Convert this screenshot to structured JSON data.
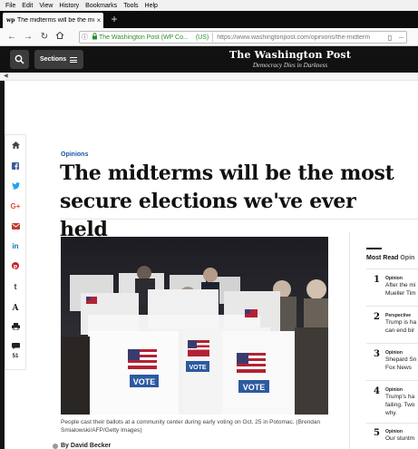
{
  "menu": [
    "File",
    "Edit",
    "View",
    "History",
    "Bookmarks",
    "Tools",
    "Help"
  ],
  "tab": {
    "title": "The midterms will be the most"
  },
  "urlbar": {
    "site": "The Washington Post (WP Co...",
    "country": "(US)",
    "url": "https://www.washingtonpost.com/opinions/the-midterm"
  },
  "header": {
    "sections_label": "Sections",
    "logo_name": "The Washington Post",
    "logo_tagline": "Democracy Dies in Darkness"
  },
  "share": {
    "comment_count": "51"
  },
  "article": {
    "kicker": "Opinions",
    "headline_line1": "The midterms will be the most",
    "headline_line2": "secure elections we've ever held",
    "caption": "People cast their ballots at a community center during early voting on Oct. 25 in Potomac. (Brendan Smialowski/AFP/Getty Images)",
    "byline": "By David Becker"
  },
  "photo": {
    "booth_sign": "VOTE"
  },
  "most_read": {
    "title_a": "Most Read",
    "title_b": "Opin",
    "items": [
      {
        "num": "1",
        "kicker": "Opinion",
        "line1": "After the mi",
        "line2": "Mueller Tim"
      },
      {
        "num": "2",
        "kicker": "Perspective",
        "line1": "Trump is ha",
        "line2": "can end bir"
      },
      {
        "num": "3",
        "kicker": "Opinion",
        "line1": "Shepard Sn",
        "line2": "Fox News"
      },
      {
        "num": "4",
        "kicker": "Opinion",
        "line1": "Trump's ha",
        "line2": "failing. Two",
        "line3": "why."
      },
      {
        "num": "5",
        "kicker": "Opinion",
        "line1": "Our stuntm",
        "line2": ""
      }
    ]
  },
  "colors": {
    "kicker_blue": "#1955a5",
    "facebook": "#3b5998",
    "twitter": "#1da1f2",
    "google": "#dd4b39",
    "email": "#c0392b",
    "linkedin": "#0077b5",
    "pinterest": "#cb2027",
    "tumblr": "#35465c"
  }
}
